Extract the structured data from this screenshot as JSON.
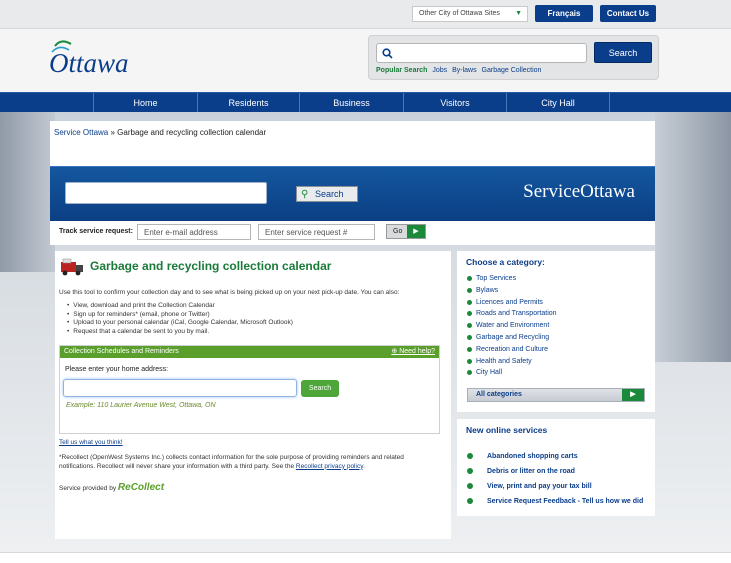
{
  "topbar": {
    "sites_select": "Other City of Ottawa Sites",
    "francais": "Français",
    "contact": "Contact Us"
  },
  "header": {
    "logo_text": "Ottawa",
    "search_button": "Search",
    "popular_label": "Popular Search",
    "popular_links": [
      "Jobs",
      "By-laws",
      "Garbage Collection"
    ]
  },
  "nav": {
    "items": [
      "Home",
      "Residents",
      "Business",
      "Visitors",
      "City Hall"
    ]
  },
  "breadcrumb": {
    "root": "Service Ottawa",
    "sep": "»",
    "current": "Garbage and recycling collection calendar"
  },
  "banner": {
    "search_button": "Search",
    "logo": "ServiceOttawa"
  },
  "track": {
    "label": "Track service request:",
    "email_placeholder": "Enter e-mail address",
    "request_placeholder": "Enter service request #",
    "go": "Go"
  },
  "content": {
    "title": "Garbage and recycling collection calendar",
    "intro": "Use this tool to confirm your collection day and to see what is being picked up on your next pick-up date. You can also:",
    "bullets": [
      "View, download and print the Collection Calendar",
      "Sign up for reminders* (email, phone or Twitter)",
      "Upload to your personal calendar (iCal, Google Calendar, Microsoft Outlook)",
      "Request that a calendar be sent to you by mail."
    ],
    "schedules_header": "Collection Schedules and Reminders",
    "need_help": "Need help?",
    "address_label": "Please enter your home address:",
    "search_button": "Search",
    "example": "Example: 110 Laurier Avenue West, Ottawa, ON",
    "tell_us": "Tell us what you think!",
    "disclaimer_1": "*Recollect (OpenWest Systems Inc.) collects contact information for the sole purpose of providing reminders and related notifications. Recollect will never share your information with a third party. See the",
    "privacy_link": "Recollect privacy policy",
    "disclaimer_2": ".",
    "provided_by": "Service provided by",
    "recollect_logo": "ReCollect"
  },
  "sidebar": {
    "category_title": "Choose a category:",
    "categories": [
      "Top Services",
      "Bylaws",
      "Licences and Permits",
      "Roads and Transportation",
      "Water and Environment",
      "Garbage and Recycling",
      "Recreation and Culture",
      "Health and Safety",
      "City Hall"
    ],
    "all_categories": "All categories",
    "news_title": "New online services",
    "news": [
      "Abandoned shopping carts",
      "Debris or litter on the road",
      "View, print and pay your tax bill",
      "Service Request Feedback - Tell us how we did"
    ]
  },
  "colors": {
    "brand_blue": "#0a3d8a",
    "brand_green": "#1a8a3a"
  }
}
